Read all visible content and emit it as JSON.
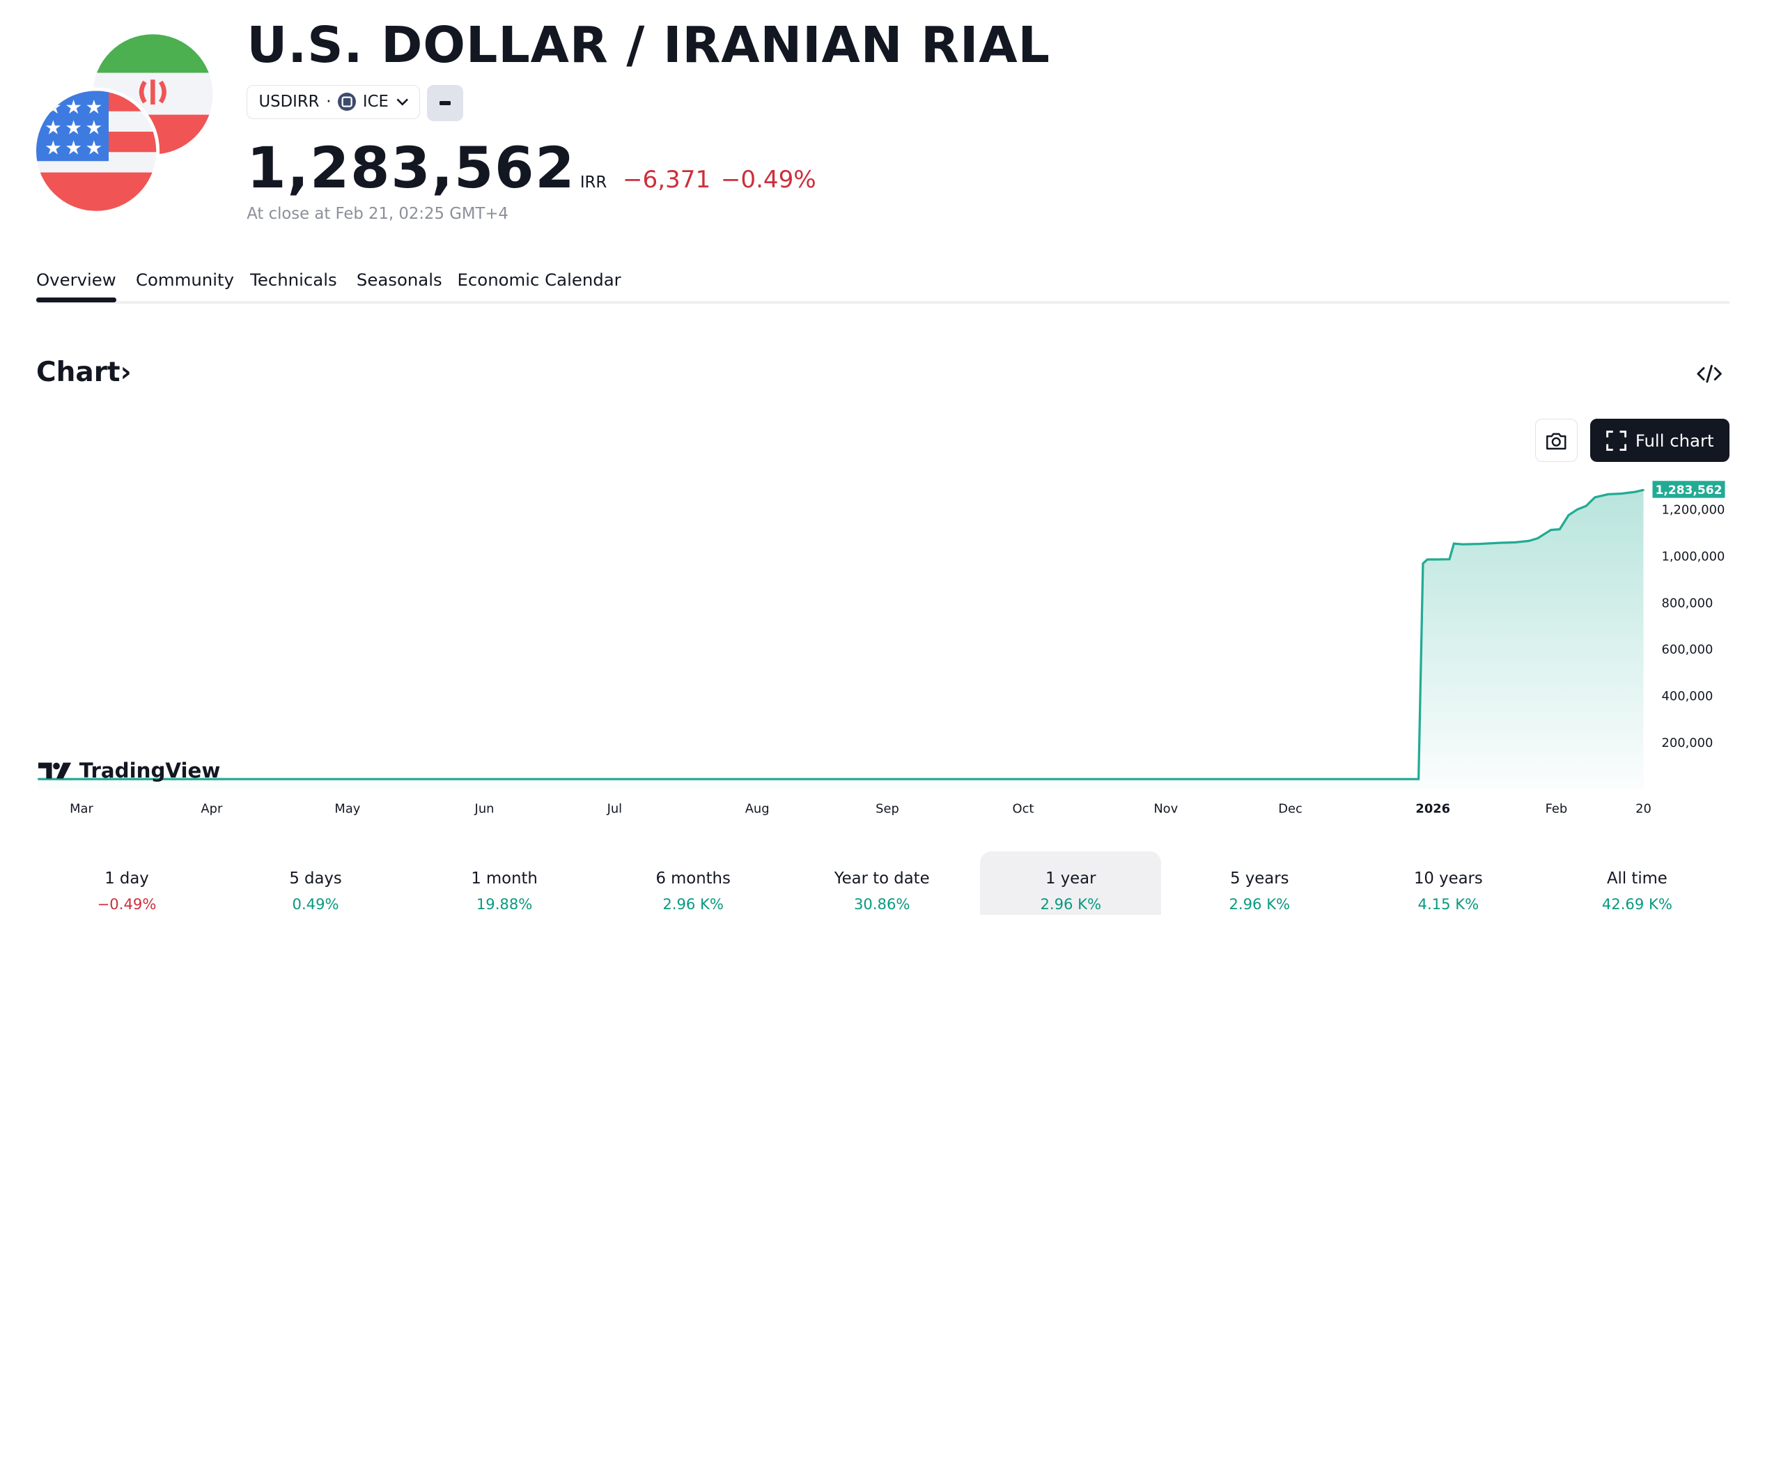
{
  "header": {
    "title": "U.S. DOLLAR / IRANIAN RIAL",
    "symbol": "USDIRR",
    "separator": "·",
    "exchange": "ICE",
    "price": "1,283,562",
    "currency": "IRR",
    "change": "−6,371",
    "change_pct": "−0.49%",
    "close_note": "At close at Feb 21, 02:25 GMT+4"
  },
  "tabs": [
    "Overview",
    "Community",
    "Technicals",
    "Seasonals",
    "Economic Calendar"
  ],
  "section": {
    "title": "Chart›"
  },
  "toolbar": {
    "full_chart_label": "Full chart"
  },
  "logo": {
    "name": "TradingView"
  },
  "colors": {
    "accent": "#22ab94",
    "down": "#cc2f3c",
    "up": "#089981",
    "text": "#131722"
  },
  "icons": [
    "iran-flag-icon",
    "us-flag-icon",
    "exchange-icon",
    "chevron-down-icon",
    "minus-icon",
    "code-embed-icon",
    "camera-icon",
    "fullscreen-icon",
    "tradingview-logo-icon"
  ],
  "chart_data": {
    "type": "area",
    "last_value_label": "1,283,562",
    "x_ticks": [
      "Mar",
      "Apr",
      "May",
      "Jun",
      "Jul",
      "Aug",
      "Sep",
      "Oct",
      "Nov",
      "Dec",
      "2026",
      "Feb",
      "20"
    ],
    "y_ticks": [
      "200,000",
      "400,000",
      "600,000",
      "800,000",
      "1,000,000",
      "1,200,000"
    ],
    "ylim": [
      0,
      1283562
    ],
    "x": [
      "2025-02-21",
      "2025-12-31",
      "2026-01-01",
      "2026-01-02",
      "2026-01-04",
      "2026-01-07",
      "2026-01-08",
      "2026-01-10",
      "2026-01-14",
      "2026-01-18",
      "2026-01-22",
      "2026-01-25",
      "2026-01-27",
      "2026-01-30",
      "2026-02-01",
      "2026-02-03",
      "2026-02-05",
      "2026-02-07",
      "2026-02-09",
      "2026-02-12",
      "2026-02-15",
      "2026-02-18",
      "2026-02-20"
    ],
    "values": [
      42000,
      42000,
      968000,
      985000,
      985000,
      986000,
      1053000,
      1050000,
      1052000,
      1056000,
      1059000,
      1065000,
      1076000,
      1112000,
      1115000,
      1175000,
      1200000,
      1215000,
      1252000,
      1265000,
      1268000,
      1275000,
      1283562
    ],
    "grid": false
  },
  "periods": [
    {
      "label": "1 day",
      "value": "−0.49%",
      "trend": "down"
    },
    {
      "label": "5 days",
      "value": "0.49%",
      "trend": "up"
    },
    {
      "label": "1 month",
      "value": "19.88%",
      "trend": "up"
    },
    {
      "label": "6 months",
      "value": "2.96 K%",
      "trend": "up"
    },
    {
      "label": "Year to date",
      "value": "30.86%",
      "trend": "up"
    },
    {
      "label": "1 year",
      "value": "2.96 K%",
      "trend": "up",
      "active": true
    },
    {
      "label": "5 years",
      "value": "2.96 K%",
      "trend": "up"
    },
    {
      "label": "10 years",
      "value": "4.15 K%",
      "trend": "up"
    },
    {
      "label": "All time",
      "value": "42.69 K%",
      "trend": "up"
    }
  ]
}
